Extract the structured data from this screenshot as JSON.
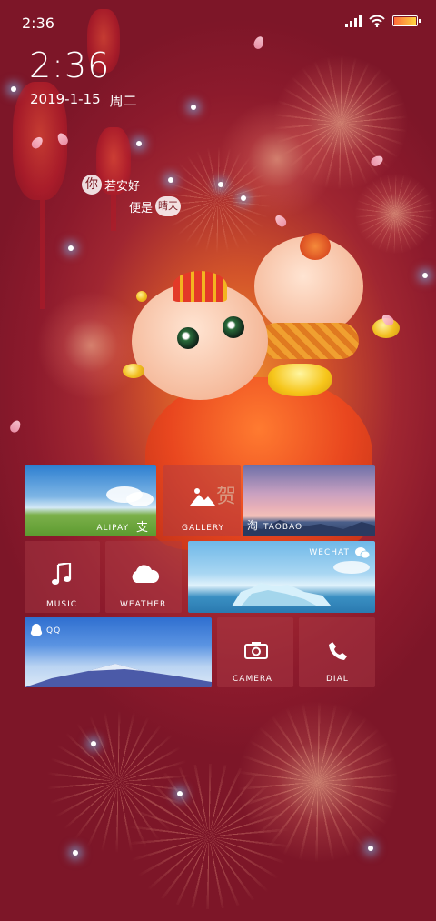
{
  "status_bar": {
    "time": "2:36"
  },
  "lockscreen": {
    "clock": "2:36",
    "date": "2019-1-15",
    "weekday": "周二"
  },
  "quote": {
    "badge_1": "你",
    "line_1_rest": "若安好",
    "line_2_start": "便是",
    "badge_2": "晴天"
  },
  "tiles": {
    "alipay": {
      "label": "ALIPAY",
      "glyph": "支"
    },
    "gallery": {
      "label": "GALLERY"
    },
    "taobao": {
      "label": "TAOBAO",
      "glyph": "淘"
    },
    "music": {
      "label": "MUSIC"
    },
    "weather": {
      "label": "WEATHER"
    },
    "wechat": {
      "label": "WECHAT"
    },
    "qq": {
      "label": "QQ"
    },
    "camera": {
      "label": "CAMERA"
    },
    "dial": {
      "label": "DIAL"
    }
  },
  "wallpaper": {
    "art_text": "贺"
  },
  "colors": {
    "background": "#8c1a2c",
    "glow": "#f0902e",
    "tile_glass": "#aa3c46"
  },
  "icons": [
    "signal-icon",
    "wifi-icon",
    "battery-icon",
    "image-icon",
    "music-note-icon",
    "cloud-icon",
    "camera-icon",
    "phone-icon",
    "penguin-icon",
    "wechat-icon"
  ]
}
